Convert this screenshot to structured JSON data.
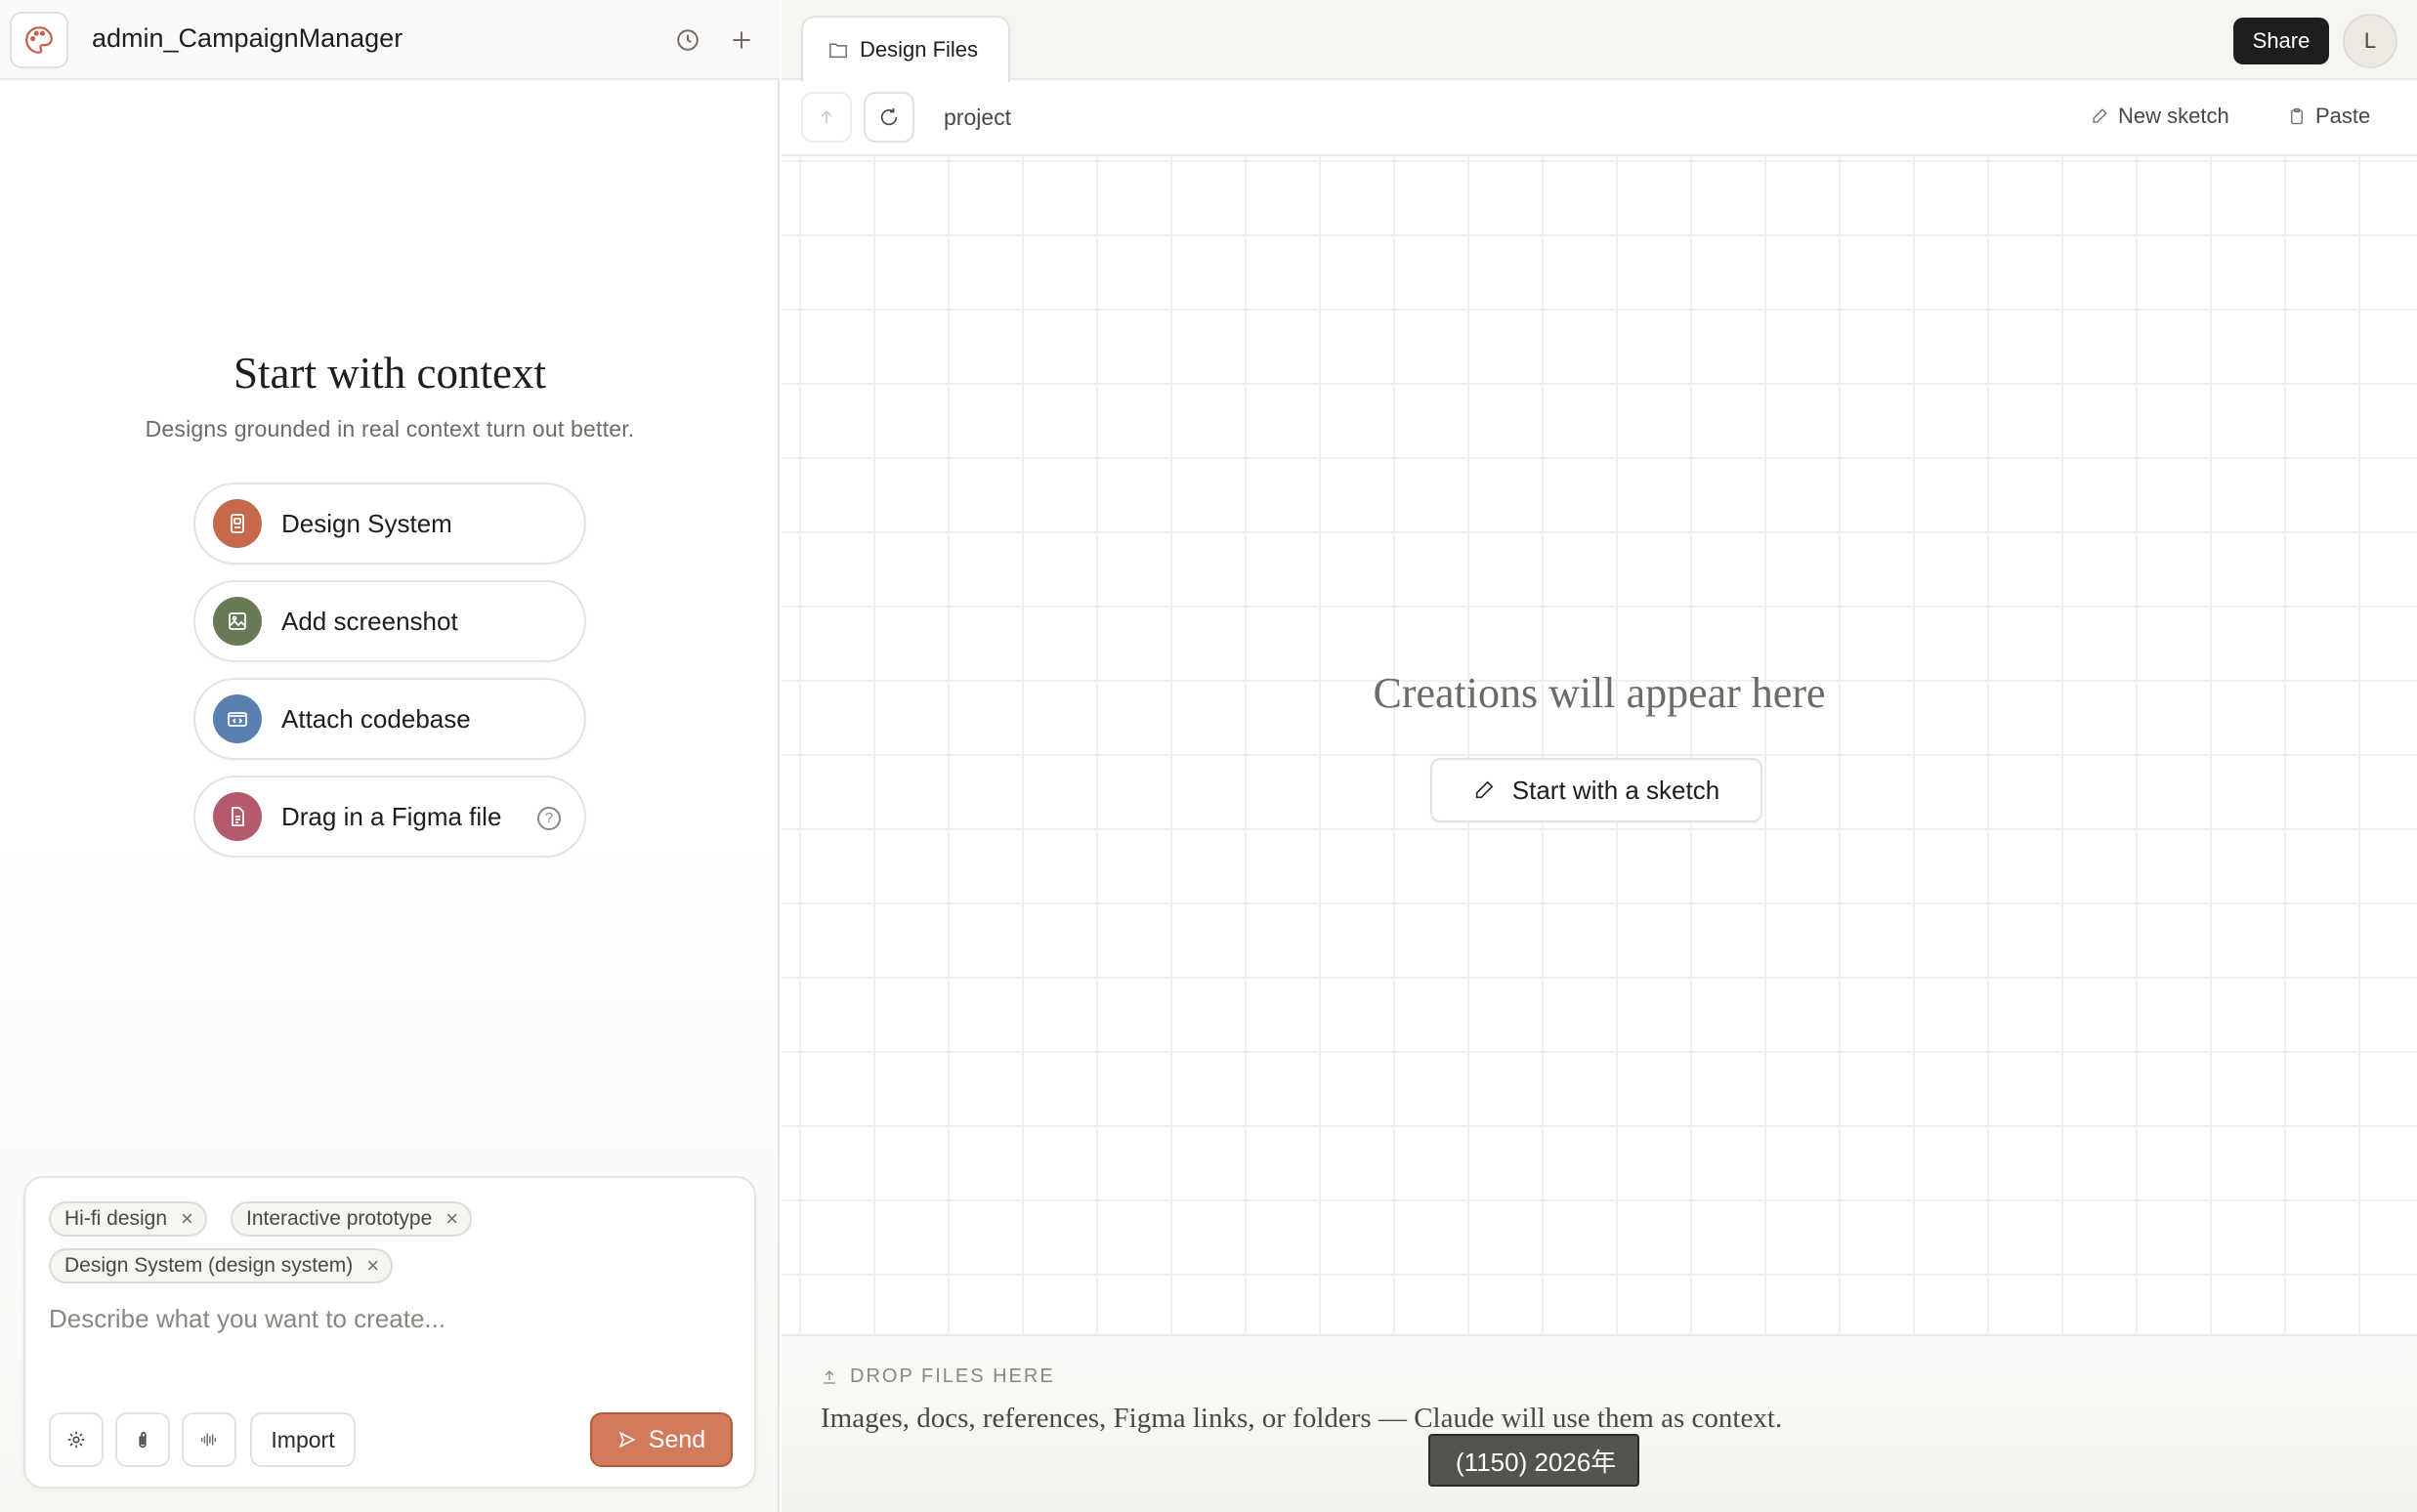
{
  "header": {
    "project_title": "admin_CampaignManager",
    "history_icon": "clock-icon",
    "add_icon": "plus-icon"
  },
  "context": {
    "title": "Start with context",
    "subtitle": "Designs grounded in real context turn out better.",
    "options": [
      {
        "label": "Design System",
        "icon": "design-system-icon",
        "color": "#c46a4a"
      },
      {
        "label": "Add screenshot",
        "icon": "image-icon",
        "color": "#667b55"
      },
      {
        "label": "Attach codebase",
        "icon": "code-icon",
        "color": "#5a80b0"
      },
      {
        "label": "Drag in a Figma file",
        "icon": "file-icon",
        "color": "#b55a6c"
      }
    ]
  },
  "composer": {
    "chips": [
      "Hi-fi design",
      "Interactive prototype",
      "Design System (design system)"
    ],
    "placeholder": "Describe what you want to create...",
    "import_label": "Import",
    "send_label": "Send"
  },
  "tab": {
    "label": "Design Files"
  },
  "topbar": {
    "share_label": "Share",
    "avatar_initial": "L"
  },
  "toolbar": {
    "path": "project",
    "new_sketch_label": "New sketch",
    "paste_label": "Paste"
  },
  "canvas": {
    "empty_title": "Creations will appear here",
    "sketch_button_label": "Start with a sketch"
  },
  "dropzone": {
    "label": "DROP FILES HERE",
    "description": "Images, docs, references, Figma links, or folders — Claude will use them as context."
  },
  "overlay": {
    "text": "(1150) 2026年"
  },
  "colors": {
    "accent": "#d27a5c",
    "dark": "#1f1e1c"
  }
}
